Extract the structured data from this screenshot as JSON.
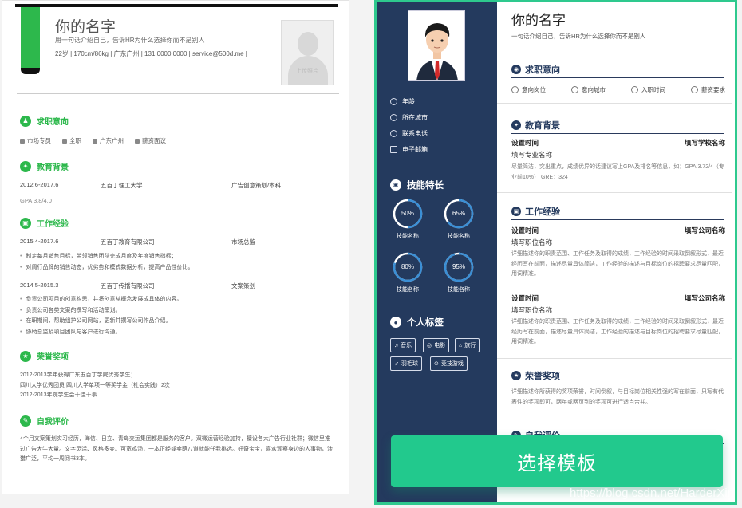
{
  "left": {
    "name": "你的名字",
    "tagline": "用一句话介绍自己，告诉HR为什么选择你而不是别人",
    "info": "22岁  |  170cm/86kg  |  广东广州  |  131 0000 0000  |  service@500d.me  |",
    "photo_label": "上传照片",
    "sections": {
      "intent": "求职意向",
      "education": "教育背景",
      "work": "工作经验",
      "honors": "荣誉奖项",
      "self": "自我评价"
    },
    "intent_items": [
      "市场专员",
      "全职",
      "广东广州",
      "薪资面议"
    ],
    "education": {
      "date": "2012.6-2017.6",
      "school": "五百丁理工大学",
      "major": "广告创意策划/本科",
      "gpa": "GPA 3.8/4.0"
    },
    "jobs": [
      {
        "date": "2015.4-2017.6",
        "company": "五百丁教育有限公司",
        "title": "市场总监",
        "bullets": [
          "制定每月销售目标，带领销售团队完成月度及年度销售指标；",
          "对周行品牌的销售动态，优劣势和模式数据分析，提高产品性价比。"
        ]
      },
      {
        "date": "2014.5-2015.3",
        "company": "五百丁传播有限公司",
        "title": "文案策划",
        "bullets": [
          "负责公司项目的创意构思，并将创意从概念发展成具体的内容。",
          "负责公司各类文案的撰写和活动策划。",
          "在职期间，帮助组护公司网站，更新并撰写公司作品介绍。",
          "协助总监及项目团队与客户进行沟通。"
        ]
      }
    ],
    "honors": [
      "2012-2013学年获得广东五百丁学院优秀学生；",
      "四川大学优秀团员 四川大学单项一等奖学金（社会实践）2次",
      "2012-2013年院学生会十佳干事"
    ],
    "self_eval": "4个月文案策划实习经历，海信、日立、青岛交运集团都是服务的客户。双微运营经验加持，擅设各大广告行业社群；微信里推过广告大牛大量。文字灵活、风格多变。可宽鸡汤，一本正经或卖萌八道就能任我挑选。好奇宝宝，喜欢观察身边的人事物，涉猎广泛，平均一周阅书3本。"
  },
  "right": {
    "name": "你的名字",
    "tagline": "一句话介绍自己，告诉HR为什么选择你而不是别人",
    "contacts": [
      "年龄",
      "所在城市",
      "联系电话",
      "电子邮箱"
    ],
    "skills_title": "技能特长",
    "skills": [
      {
        "value": "50%",
        "label": "技能名称",
        "fraction": 0.5
      },
      {
        "value": "65%",
        "label": "技能名称",
        "fraction": 0.65
      },
      {
        "value": "80%",
        "label": "技能名称",
        "fraction": 0.8
      },
      {
        "value": "95%",
        "label": "技能名称",
        "fraction": 0.95
      }
    ],
    "tags_title": "个人标签",
    "tags": [
      "音乐",
      "电影",
      "旅行",
      "羽毛球",
      "竞技游戏"
    ],
    "sections": {
      "intent": "求职意向",
      "education": "教育背景",
      "work": "工作经验",
      "honors": "荣誉奖项",
      "self": "自我评价"
    },
    "intent_items": [
      "意向岗位",
      "意向城市",
      "入职时间",
      "薪资要求"
    ],
    "education": {
      "time": "设置时间",
      "school": "填写学校名称",
      "major": "填写专业名称",
      "desc": "尽量简洁，突出重点，成绩优异的话建议写上GPA及排名等信息，如：GPA:3.72/4（专业前10%） GRE：324"
    },
    "jobs": [
      {
        "time": "设置时间",
        "company": "填写公司名称",
        "position": "填写职位名称",
        "desc": "详细描述你的职责范围、工作任务及取得的成绩，工作经验的时间采取倒叙形式，最近经历写在前面，描述尽量具体简洁，工作经验的描述与目标岗位的招聘要求尽量匹配，用词精准。"
      },
      {
        "time": "设置时间",
        "company": "填写公司名称",
        "position": "填写职位名称",
        "desc": "详细描述你的职责范围、工作任务及取得的成绩，工作经验的时间采取倒叙形式，最近经历写在前面，描述尽量具体简洁，工作经验的描述与目标岗位的招聘要求尽量匹配，用词精准。"
      }
    ],
    "honors_desc": "详细描述你所获得的奖项荣誉，时间倒叙，与目标岗位相关性强的写在前面，只写有代表性的奖项即可，两年或两页到的奖项可进行适当合并。"
  },
  "cta": {
    "label": "选择模板"
  },
  "watermark": "https://blog.csdn.net/HarderXin",
  "colors": {
    "left_accent": "#2db84c",
    "right_sidebar": "#243a5e",
    "cta": "#22c98d",
    "selected_border": "#2ec98e"
  }
}
